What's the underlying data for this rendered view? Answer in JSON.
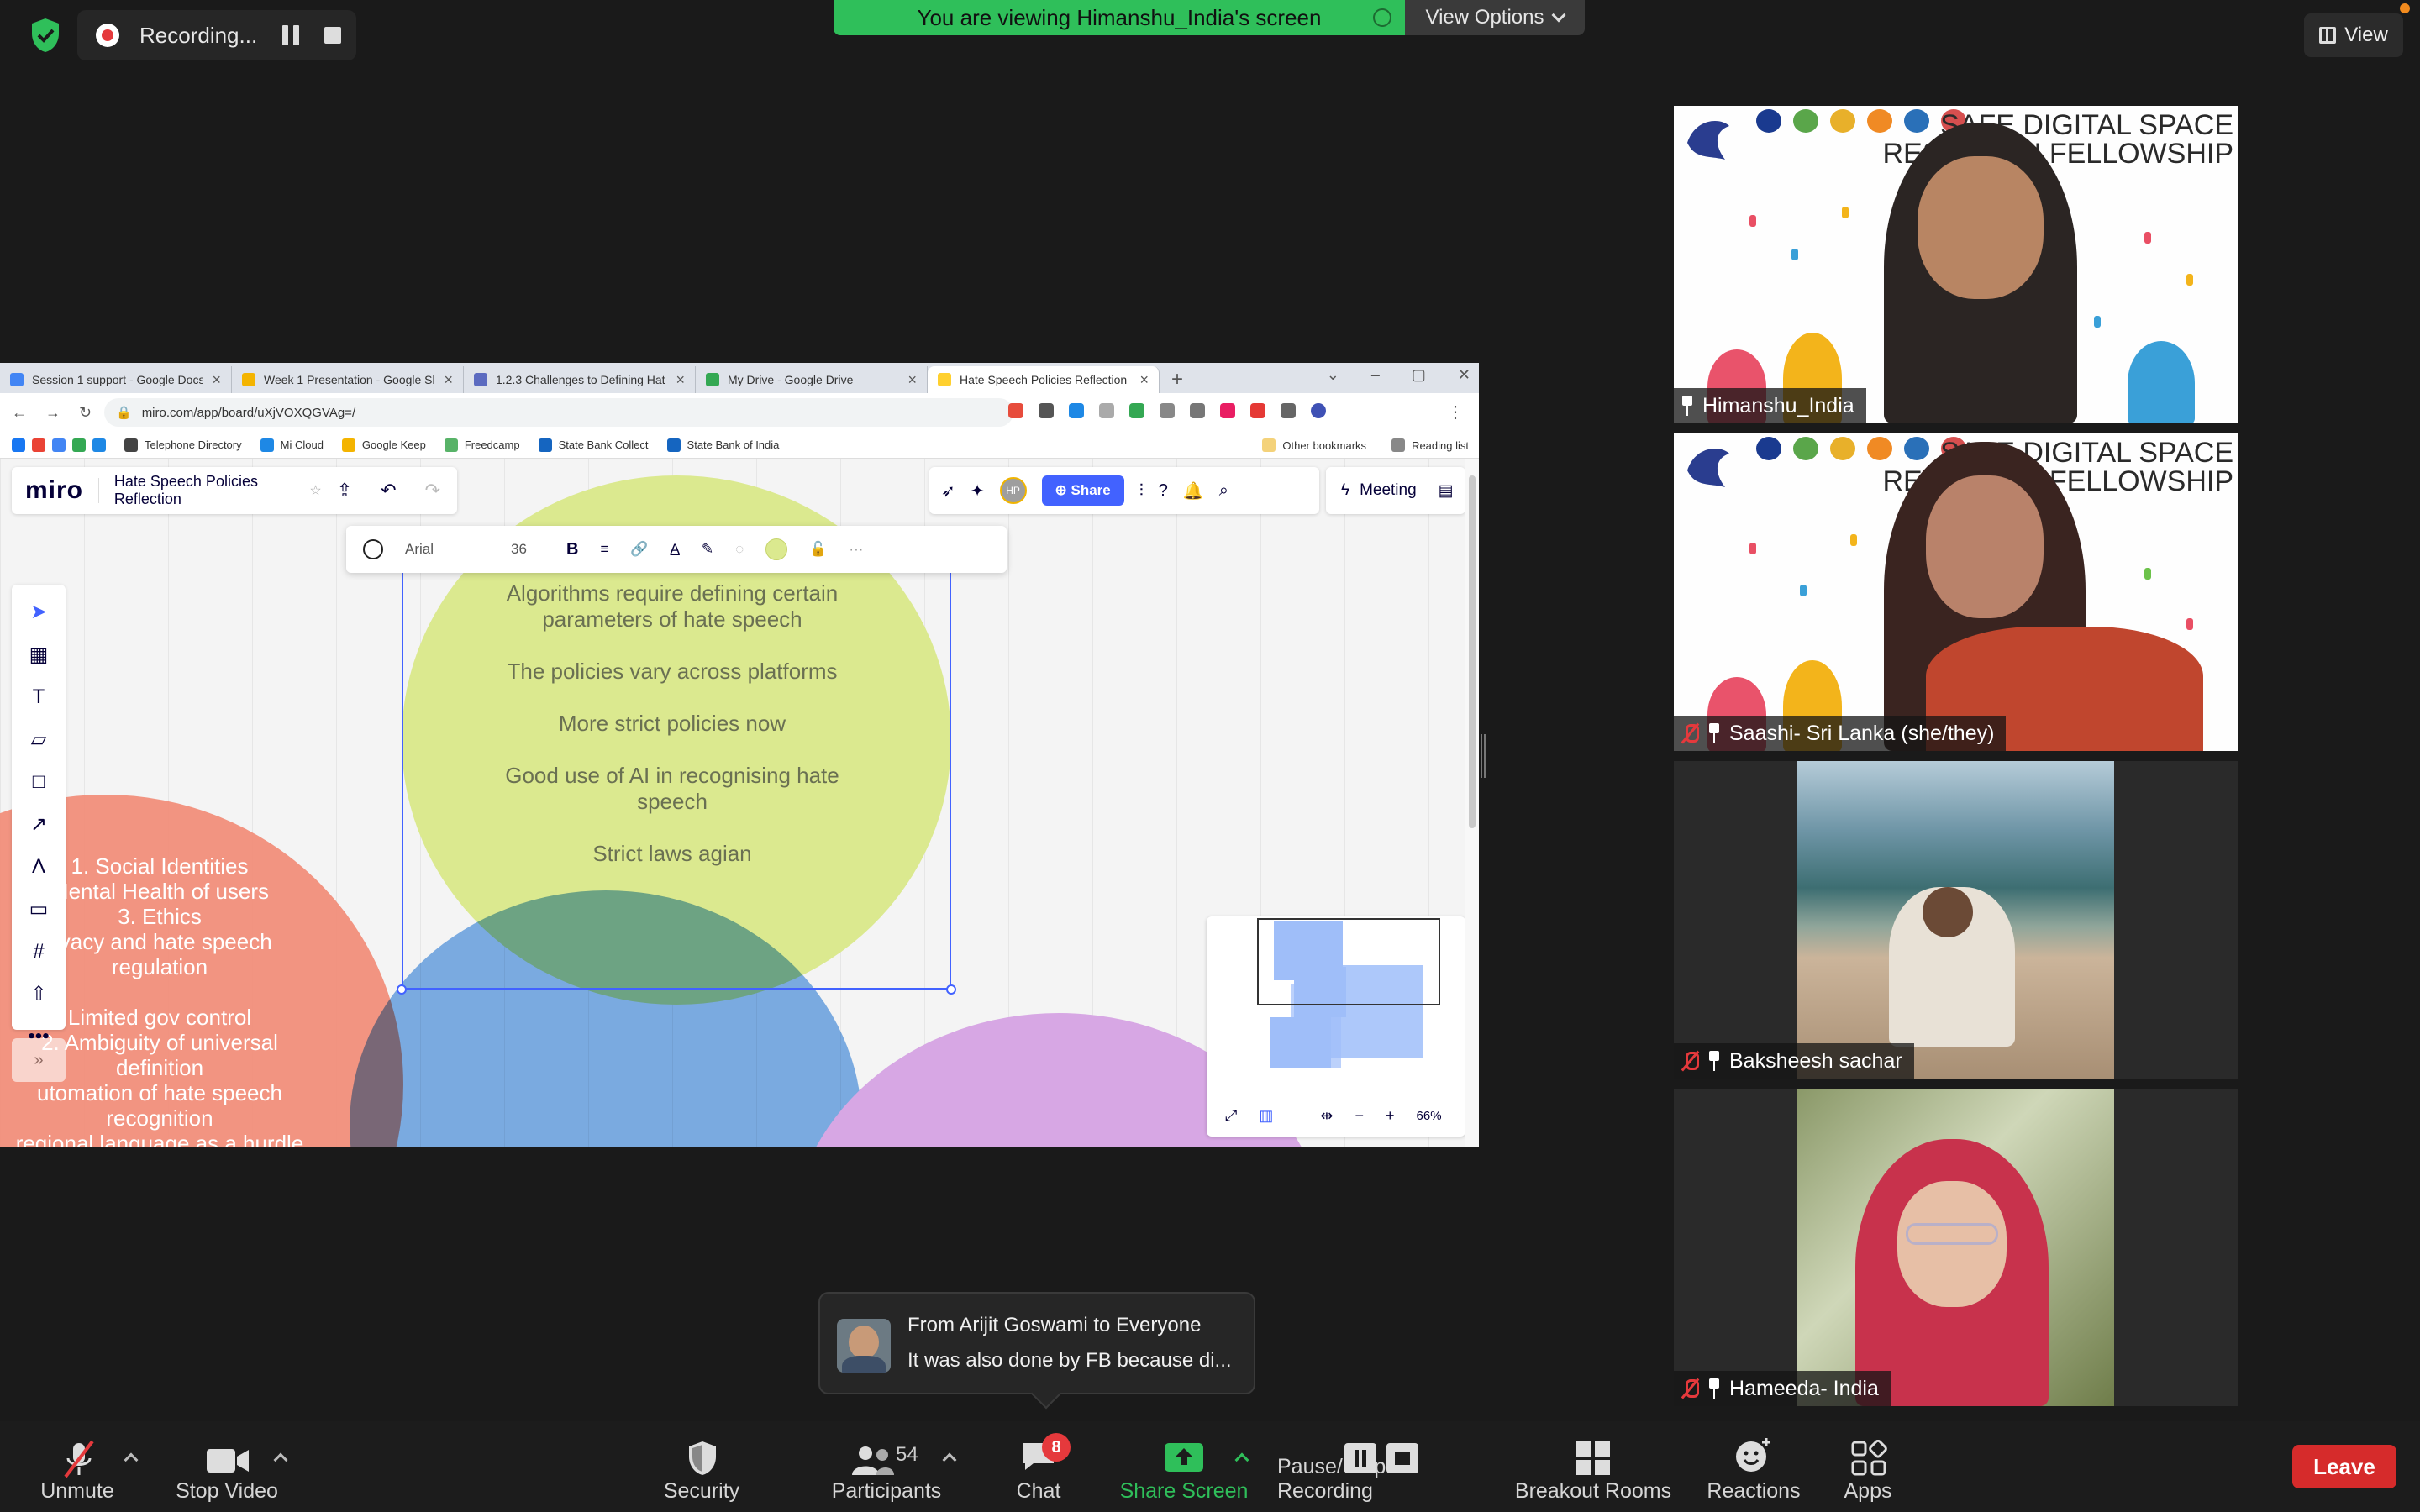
{
  "recording": {
    "label": "Recording..."
  },
  "banner": {
    "viewing": "You are viewing Himanshu_India's screen",
    "view_options": "View Options"
  },
  "view_button": "View",
  "browser": {
    "tabs": [
      {
        "label": "Session 1 support - Google Docs",
        "color": "#4285f4"
      },
      {
        "label": "Week 1 Presentation - Google Sl",
        "color": "#f4b400"
      },
      {
        "label": "1.2.3 Challenges to Defining Hat",
        "color": "#5c6bc0"
      },
      {
        "label": "My Drive - Google Drive",
        "color": "#34a853"
      },
      {
        "label": "Hate Speech Policies Reflection",
        "color": "#ffd02f"
      }
    ],
    "url": "miro.com/app/board/uXjVOXQGVAg=/",
    "bookmarks": [
      {
        "label": "Telephone Directory",
        "color": "#444"
      },
      {
        "label": "Mi Cloud",
        "color": "#1e88e5"
      },
      {
        "label": "Google Keep",
        "color": "#f4b400"
      },
      {
        "label": "Freedcamp",
        "color": "#58b368"
      },
      {
        "label": "State Bank Collect",
        "color": "#1565c0"
      },
      {
        "label": "State Bank of India",
        "color": "#1565c0"
      }
    ],
    "bookmarks_right": [
      "Other bookmarks",
      "Reading list"
    ]
  },
  "miro": {
    "logo": "miro",
    "board_title": "Hate Speech Policies Reflection",
    "share": "Share",
    "meeting": "Meeting",
    "avatar": "HP",
    "font": "Arial",
    "font_size": "36",
    "zoom": "66%",
    "green_notes": [
      "Algorithms require defining certain parameters of hate speech",
      "The policies vary across platforms",
      "More strict policies now",
      "Good use of AI in recognising hate speech",
      "Strict laws agian"
    ],
    "red_notes": [
      "1. Social Identities",
      "Mental Health of users",
      "3. Ethics",
      "rivacy and hate speech",
      "regulation",
      "",
      "Limited gov control",
      "2. Ambiguity of universal",
      "definition",
      "utomation of hate speech",
      "recognition",
      "regional language as a hurdle"
    ]
  },
  "participants_tiles": [
    {
      "name": "Himanshu_India",
      "muted": false
    },
    {
      "name": "Saashi- Sri Lanka  (she/they)",
      "muted": true
    },
    {
      "name": "Baksheesh sachar",
      "muted": true
    },
    {
      "name": "Hameeda- India",
      "muted": true
    }
  ],
  "tile_banner": {
    "line1": "SAFE DIGITAL SPACE",
    "line2": "RESEARCH FELLOWSHIP"
  },
  "chat_toast": {
    "from": "From Arijit Goswami to Everyone",
    "message": "It was also done by FB because di..."
  },
  "toolbar": {
    "unmute": "Unmute",
    "stop_video": "Stop Video",
    "security": "Security",
    "participants": "Participants",
    "participants_count": "54",
    "chat": "Chat",
    "chat_badge": "8",
    "share_screen": "Share Screen",
    "pause_stop": "Pause/Stop Recording",
    "breakout": "Breakout Rooms",
    "reactions": "Reactions",
    "apps": "Apps",
    "leave": "Leave"
  },
  "colors": {
    "zoom_green": "#2fbf5a",
    "leave_red": "#d62b2b",
    "miro_blue": "#4262ff"
  }
}
